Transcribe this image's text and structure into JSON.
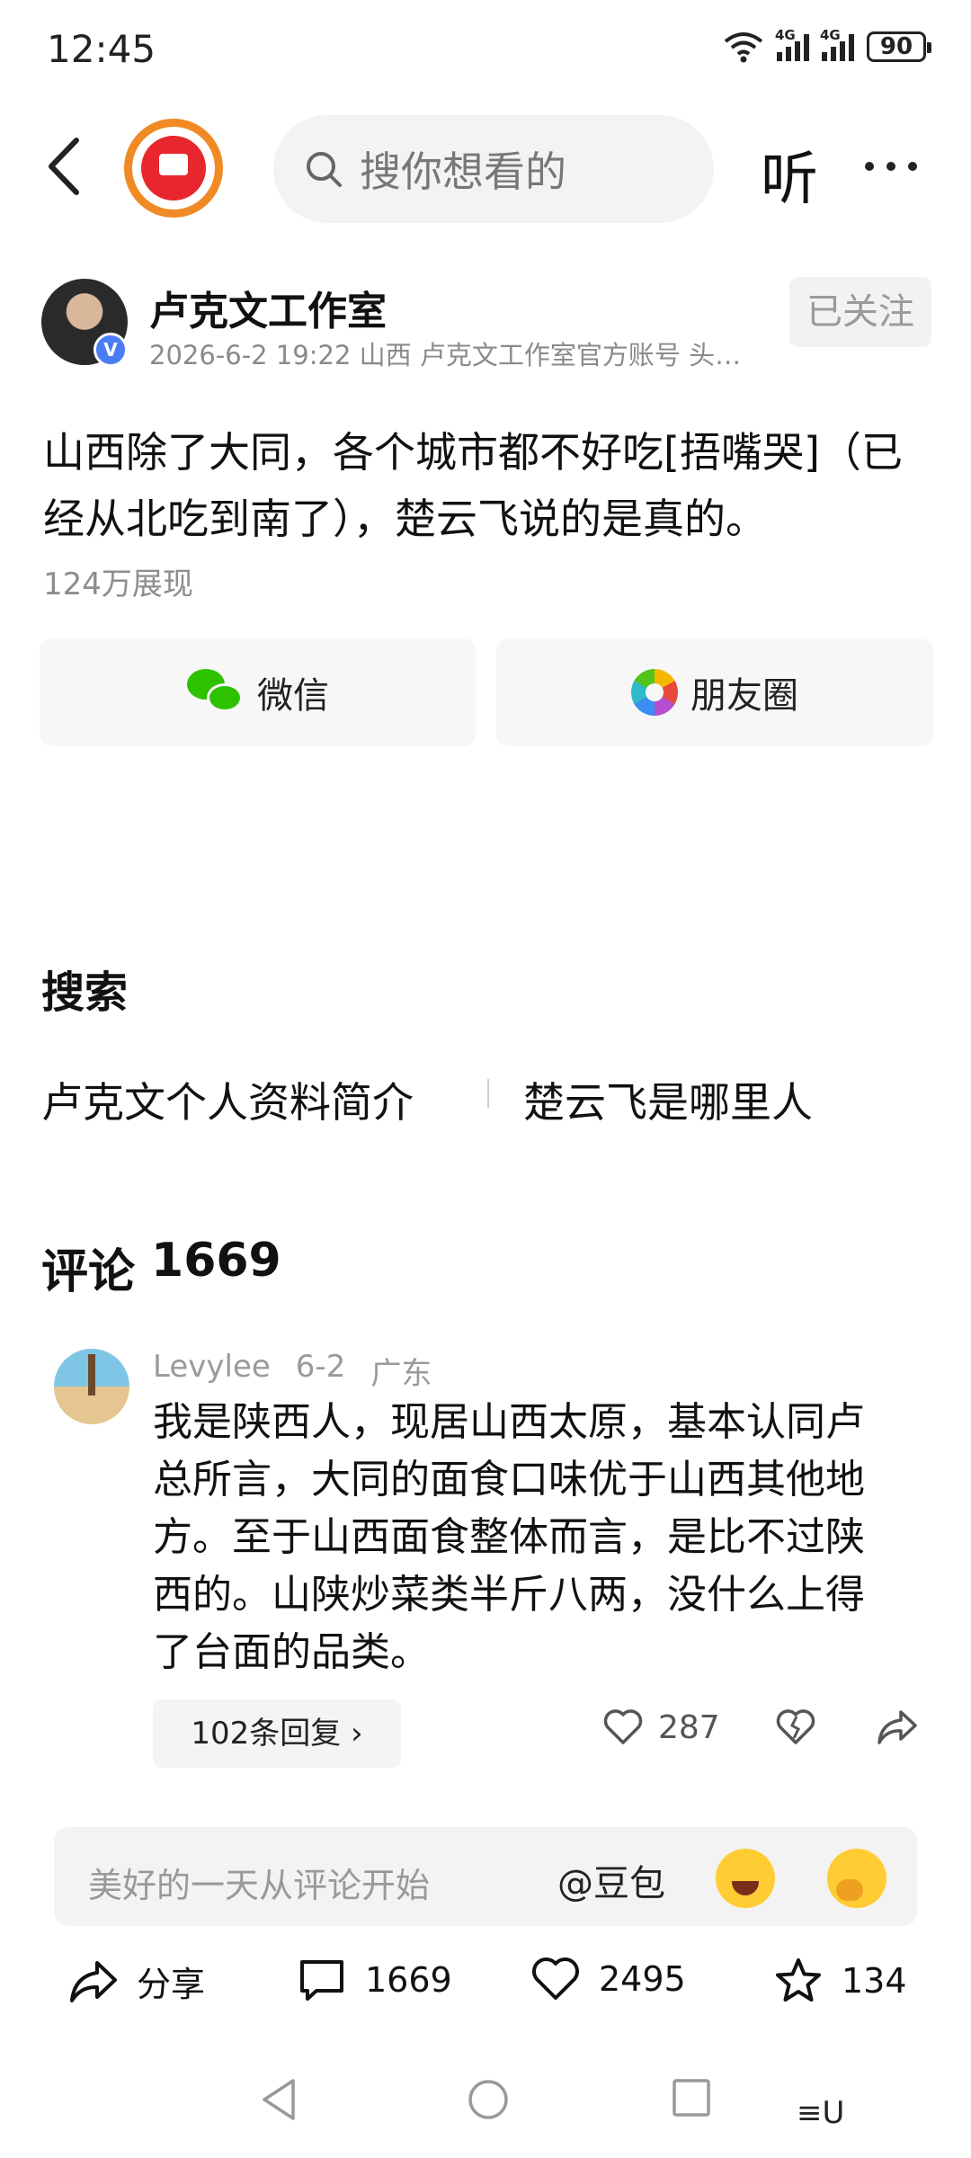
{
  "status_bar": {
    "time": "12:45",
    "signal1_label": "4G",
    "signal2_label": "4G",
    "battery": "90"
  },
  "nav": {
    "search_placeholder": "搜你想看的",
    "listen_label": "听"
  },
  "author": {
    "name": "卢克文工作室",
    "meta": "2026-6-2 19:22 山西 卢克文工作室官方账号 头…",
    "follow_label": "已关注"
  },
  "post": {
    "text": "山西除了大同，各个城市都不好吃[捂嘴哭]（已经从北吃到南了），楚云飞说的是真的。",
    "views": "124万展现"
  },
  "share": {
    "wechat_label": "微信",
    "moments_label": "朋友圈"
  },
  "search_section": {
    "title": "搜索",
    "suggestions": [
      "卢克文个人资料简介",
      "楚云飞是哪里人"
    ]
  },
  "comments": {
    "title": "评论",
    "count": "1669",
    "items": [
      {
        "user": "Levylee",
        "date": "6-2",
        "location": "广东",
        "text": "我是陕西人，现居山西太原，基本认同卢总所言，大同的面食口味优于山西其他地方。至于山西面食整体而言，是比不过陕西的。山陕炒菜类半斤八两，没什么上得了台面的品类。",
        "replies_label": "102条回复 ›",
        "likes": "287"
      }
    ]
  },
  "input_bar": {
    "placeholder": "美好的一天从评论开始",
    "at_label": "@豆包"
  },
  "actions": {
    "share_label": "分享",
    "comments": "1669",
    "likes": "2495",
    "favorites": "134"
  },
  "system_nav": {
    "extra_label": "≡U"
  }
}
